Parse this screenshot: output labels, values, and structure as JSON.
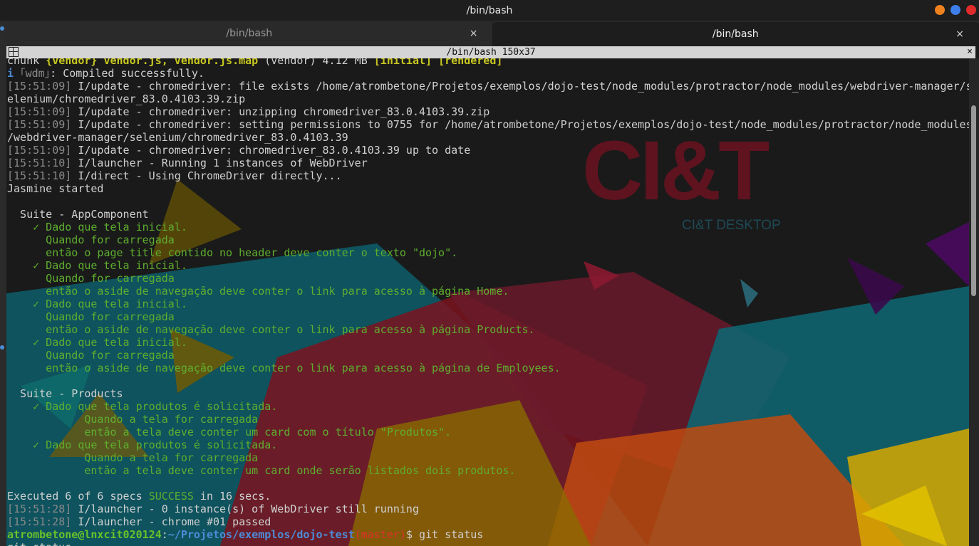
{
  "window": {
    "title": "/bin/bash",
    "controls": [
      {
        "name": "minimize",
        "color": "#f0821e"
      },
      {
        "name": "maximize",
        "color": "#3d7ee8"
      },
      {
        "name": "close",
        "color": "#e02a2a"
      }
    ]
  },
  "tabs": [
    {
      "label": "/bin/bash",
      "active": false,
      "close": "×"
    },
    {
      "label": "/bin/bash",
      "active": true,
      "close": "×"
    }
  ],
  "terminal": {
    "title": "/bin/bash 150x37",
    "close": "×",
    "wallpaper": {
      "logo": "CI&T",
      "subtitle": "CI&T DESKTOP"
    },
    "lines": [
      [
        {
          "t": "chunk ",
          "c": ""
        },
        {
          "t": "{vendor} ",
          "c": "y"
        },
        {
          "t": "vendor.js, vendor.js.map",
          "c": "y"
        },
        {
          "t": " (vendor) 4.12 MB ",
          "c": ""
        },
        {
          "t": "[initial] [rendered]",
          "c": "y"
        }
      ],
      [
        {
          "t": "i ",
          "c": "prompt-path"
        },
        {
          "t": "｢wdm｣",
          "c": "ts"
        },
        {
          "t": ": Compiled successfully.",
          "c": ""
        }
      ],
      [
        {
          "t": "[15:51:09]",
          "c": "ts"
        },
        {
          "t": " I/update - chromedriver: file exists /home/atrombetone/Projetos/exemplos/dojo-test/node_modules/protractor/node_modules/webdriver-manager/s",
          "c": ""
        }
      ],
      [
        {
          "t": "elenium/chromedriver_83.0.4103.39.zip",
          "c": ""
        }
      ],
      [
        {
          "t": "[15:51:09]",
          "c": "ts"
        },
        {
          "t": " I/update - chromedriver: unzipping chromedriver_83.0.4103.39.zip",
          "c": ""
        }
      ],
      [
        {
          "t": "[15:51:09]",
          "c": "ts"
        },
        {
          "t": " I/update - chromedriver: setting permissions to 0755 for /home/atrombetone/Projetos/exemplos/dojo-test/node_modules/protractor/node_modules",
          "c": ""
        }
      ],
      [
        {
          "t": "/webdriver-manager/selenium/chromedriver_83.0.4103.39",
          "c": ""
        }
      ],
      [
        {
          "t": "[15:51:09]",
          "c": "ts"
        },
        {
          "t": " I/update - chromedriver: chromedriver_83.0.4103.39 up to date",
          "c": ""
        }
      ],
      [
        {
          "t": "[15:51:10]",
          "c": "ts"
        },
        {
          "t": " I/launcher - Running 1 instances of WebDriver",
          "c": ""
        }
      ],
      [
        {
          "t": "[15:51:10]",
          "c": "ts"
        },
        {
          "t": " I/direct - Using ChromeDriver directly...",
          "c": ""
        }
      ],
      [
        {
          "t": "Jasmine started",
          "c": ""
        }
      ],
      [
        {
          "t": "",
          "c": ""
        }
      ],
      [
        {
          "t": "  Suite - AppComponent",
          "c": ""
        }
      ],
      [
        {
          "t": "    ✓ Dado que tela inicial.",
          "c": "g"
        }
      ],
      [
        {
          "t": "      Quando for carregada",
          "c": "g"
        }
      ],
      [
        {
          "t": "      então o page title contido no header deve conter o texto \"dojo\".",
          "c": "g"
        }
      ],
      [
        {
          "t": "    ✓ Dado que tela inicial.",
          "c": "g"
        }
      ],
      [
        {
          "t": "      Quando for carregada",
          "c": "g"
        }
      ],
      [
        {
          "t": "      então o aside de navegação deve conter o link para acesso à página Home.",
          "c": "g"
        }
      ],
      [
        {
          "t": "    ✓ Dado que tela inicial.",
          "c": "g"
        }
      ],
      [
        {
          "t": "      Quando for carregada",
          "c": "g"
        }
      ],
      [
        {
          "t": "      então o aside de navegação deve conter o link para acesso à página Products.",
          "c": "g"
        }
      ],
      [
        {
          "t": "    ✓ Dado que tela inicial.",
          "c": "g"
        }
      ],
      [
        {
          "t": "      Quando for carregada",
          "c": "g"
        }
      ],
      [
        {
          "t": "      então o aside de navegação deve conter o link para acesso à página de Employees.",
          "c": "g"
        }
      ],
      [
        {
          "t": "",
          "c": ""
        }
      ],
      [
        {
          "t": "  Suite - Products",
          "c": ""
        }
      ],
      [
        {
          "t": "    ✓ Dado que tela produtos é solicitada.",
          "c": "g"
        }
      ],
      [
        {
          "t": "            Quando a tela for carregada",
          "c": "g"
        }
      ],
      [
        {
          "t": "            então a tela deve conter um card com o título \"Produtos\".",
          "c": "g"
        }
      ],
      [
        {
          "t": "    ✓ Dado que tela produtos é solicitada.",
          "c": "g"
        }
      ],
      [
        {
          "t": "            Quando a tela for carregada",
          "c": "g"
        }
      ],
      [
        {
          "t": "            então a tela deve conter um card onde serão listados dois produtos.",
          "c": "g"
        }
      ],
      [
        {
          "t": "",
          "c": ""
        }
      ],
      [
        {
          "t": "Executed 6 of 6 specs ",
          "c": ""
        },
        {
          "t": "SUCCESS",
          "c": "g"
        },
        {
          "t": " in 16 secs.",
          "c": ""
        }
      ],
      [
        {
          "t": "[15:51:28]",
          "c": "ts"
        },
        {
          "t": " I/launcher - 0 instance(s) of WebDriver still running",
          "c": ""
        }
      ],
      [
        {
          "t": "[15:51:28]",
          "c": "ts"
        },
        {
          "t": " I/launcher - chrome #01 passed",
          "c": ""
        }
      ],
      [
        {
          "t": "atrombetone@lnxcit020124",
          "c": "prompt-user"
        },
        {
          "t": ":",
          "c": ""
        },
        {
          "t": "~/Projetos/exemplos/dojo-test",
          "c": "prompt-path"
        },
        {
          "t": "(master)",
          "c": "prompt-branch"
        },
        {
          "t": "$ git status",
          "c": ""
        }
      ],
      [
        {
          "t": "git status",
          "c": ""
        }
      ]
    ]
  }
}
